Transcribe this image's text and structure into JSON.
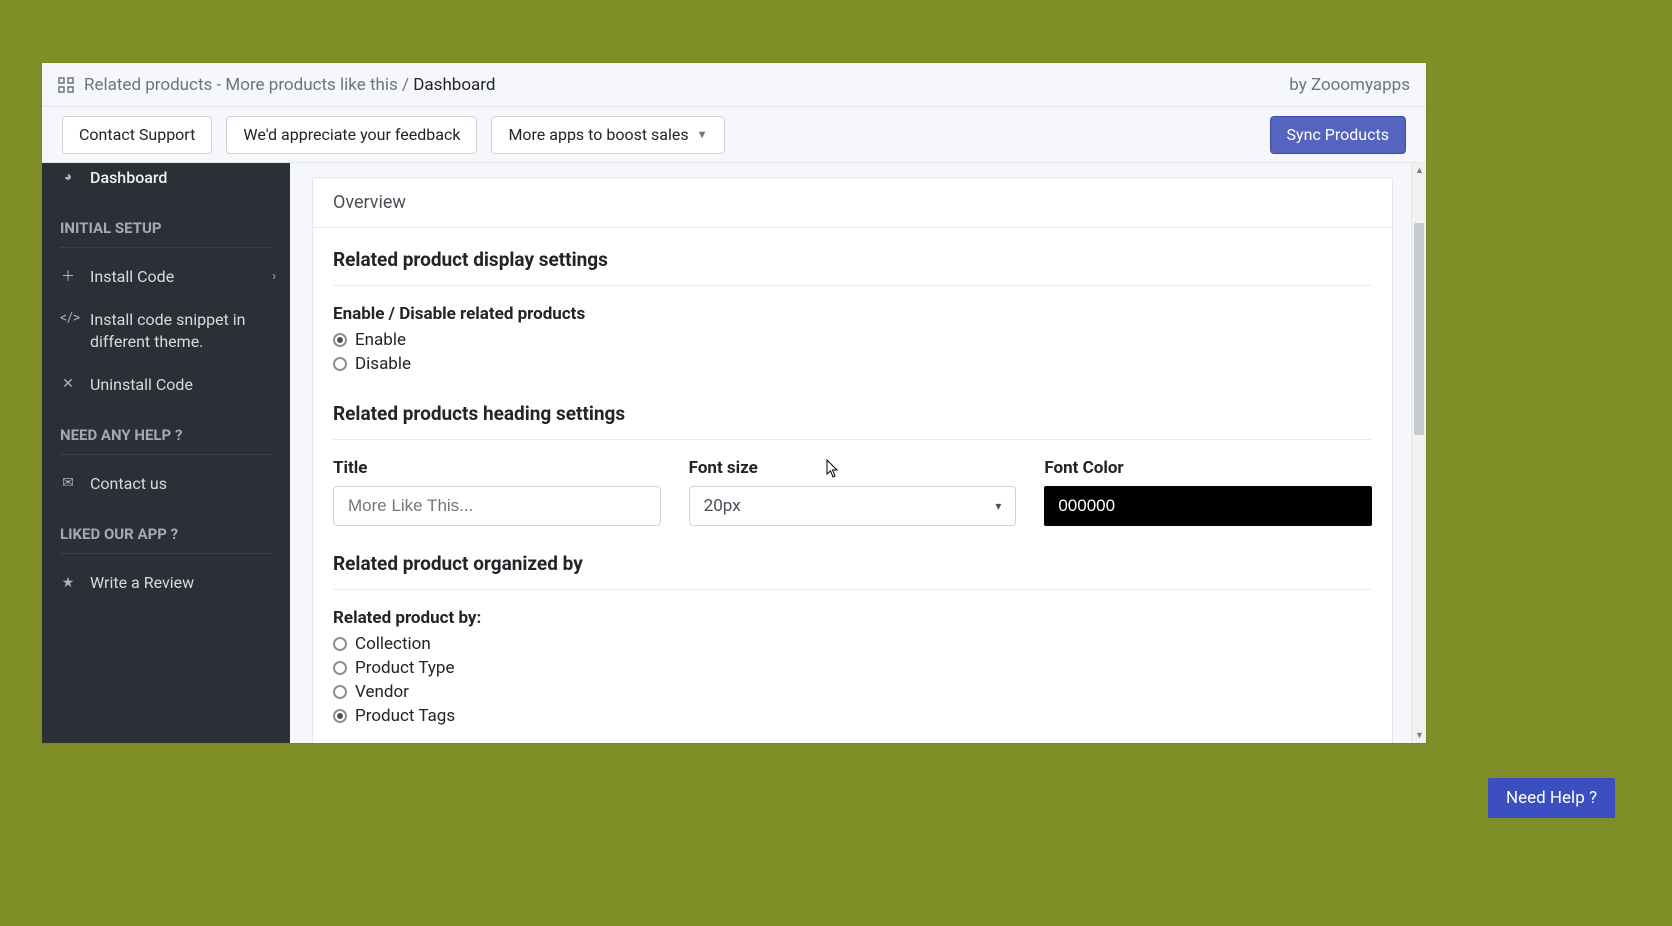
{
  "header": {
    "app_title": "Related products - More products like this",
    "breadcrumb_current": "Dashboard",
    "by_line": "by Zooomyapps"
  },
  "actionbar": {
    "contact_support": "Contact Support",
    "feedback": "We'd appreciate your feedback",
    "more_apps": "More apps to boost sales",
    "sync_products": "Sync Products"
  },
  "sidebar": {
    "dashboard": "Dashboard",
    "section_initial_setup": "INITIAL SETUP",
    "install_code": "Install Code",
    "install_snippet": "Install code snippet in different theme.",
    "uninstall_code": "Uninstall Code",
    "section_help": "NEED ANY HELP ?",
    "contact_us": "Contact us",
    "section_liked": "LIKED OUR APP ?",
    "write_review": "Write a Review"
  },
  "main": {
    "overview": "Overview",
    "section_display_settings": "Related product display settings",
    "enable_disable_label": "Enable / Disable related products",
    "enable": "Enable",
    "disable": "Disable",
    "enable_selected": true,
    "section_heading_settings": "Related products heading settings",
    "title_label": "Title",
    "title_placeholder": "More Like This...",
    "font_size_label": "Font size",
    "font_size_value": "20px",
    "font_color_label": "Font Color",
    "font_color_value": "000000",
    "section_organized_by": "Related product organized by",
    "related_by_label": "Related product by:",
    "options": {
      "collection": "Collection",
      "product_type": "Product Type",
      "vendor": "Vendor",
      "product_tags": "Product Tags"
    },
    "organized_selected": "product_tags"
  },
  "need_help": "Need Help ?"
}
